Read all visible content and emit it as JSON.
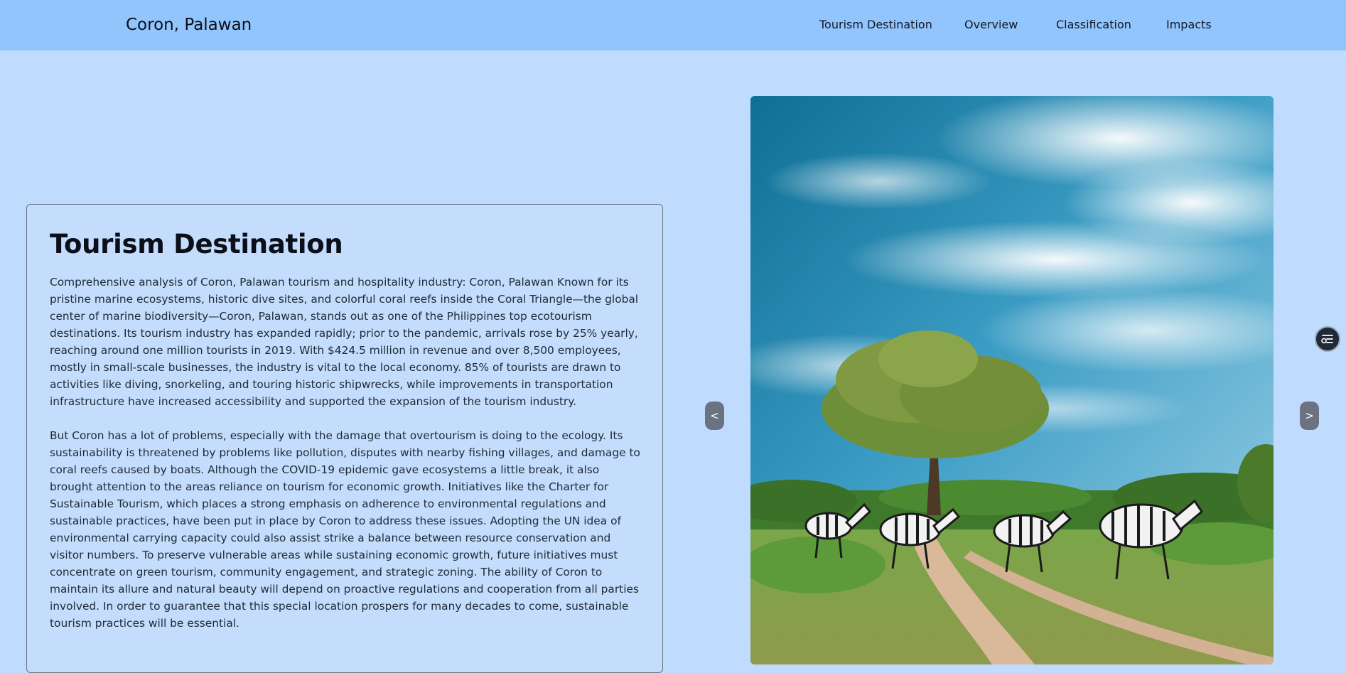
{
  "header": {
    "brand": "Coron, Palawan",
    "nav": [
      {
        "label": "Tourism Destination"
      },
      {
        "label": "Overview"
      },
      {
        "label": "Classification"
      },
      {
        "label": "Impacts"
      }
    ]
  },
  "main": {
    "title": "Tourism Destination",
    "paragraphs": [
      "Comprehensive analysis of Coron, Palawan tourism and hospitality industry: Coron, Palawan Known for its pristine marine ecosystems, historic dive sites, and colorful coral reefs inside the Coral Triangle—the global center of marine biodiversity—Coron, Palawan, stands out as one of the Philippines top ecotourism destinations. Its tourism industry has expanded rapidly; prior to the pandemic, arrivals rose by 25% yearly, reaching around one million tourists in 2019. With $424.5 million in revenue and over 8,500 employees, mostly in small-scale businesses, the industry is vital to the local economy. 85% of tourists are drawn to activities like diving, snorkeling, and touring historic shipwrecks, while improvements in transportation infrastructure have increased accessibility and supported the expansion of the tourism industry.",
      "But Coron has a lot of problems, especially with the damage that overtourism is doing to the ecology. Its sustainability is threatened by problems like pollution, disputes with nearby fishing villages, and damage to coral reefs caused by boats. Although the COVID-19 epidemic gave ecosystems a little break, it also brought attention to the areas reliance on tourism for economic growth. Initiatives like the Charter for Sustainable Tourism, which places a strong emphasis on adherence to environmental regulations and sustainable practices, have been put in place by Coron to address these issues. Adopting the UN idea of environmental carrying capacity could also assist strike a balance between resource conservation and visitor numbers. To preserve vulnerable areas while sustaining economic growth, future initiatives must concentrate on green tourism, community engagement, and strategic zoning. The ability of Coron to maintain its allure and natural beauty will depend on proactive regulations and cooperation from all parties involved. In order to guarantee that this special location prospers for many decades to come, sustainable tourism practices will be essential."
    ]
  },
  "carousel": {
    "prev_label": "<",
    "next_label": ">"
  },
  "colors": {
    "page_background": "#bfdbfe",
    "navbar": "#93c5fd",
    "card_border": "#6b7280",
    "carousel_button": "#6b7280",
    "fab_background": "#1f2937"
  },
  "icons": {
    "fab": "filter-list-icon"
  }
}
